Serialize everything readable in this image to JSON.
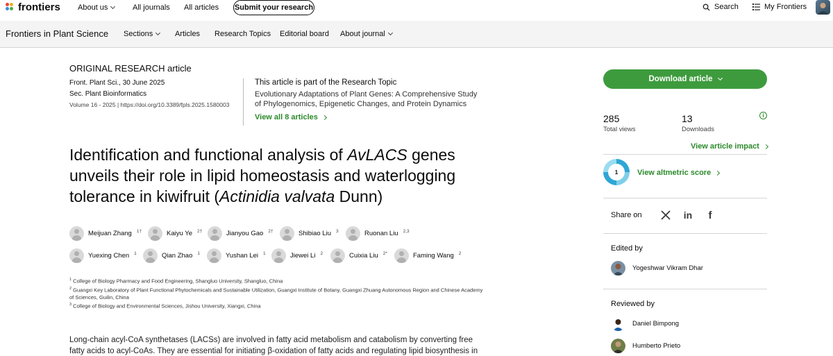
{
  "topbar": {
    "logo_text": "frontiers",
    "nav": [
      "About us",
      "All journals",
      "All articles"
    ],
    "submit_label": "Submit your research",
    "search_label": "Search",
    "my_frontiers_label": "My Frontiers"
  },
  "journal_bar": {
    "title": "Frontiers in Plant Science",
    "nav": [
      "Sections",
      "Articles",
      "Research Topics",
      "Editorial board",
      "About journal"
    ]
  },
  "article": {
    "type": "ORIGINAL RESEARCH article",
    "citation": "Front. Plant Sci., 30 June 2025",
    "section": "Sec. Plant Bioinformatics",
    "volume_doi": "Volume 16 - 2025 | https://doi.org/10.3389/fpls.2025.1580003",
    "topic_heading": "This article is part of the Research Topic",
    "topic_title": "Evolutionary Adaptations of Plant Genes: A Comprehensive Study of Phylogenomics, Epigenetic Changes, and Protein Dynamics",
    "topic_link": "View all 8 articles",
    "title_part1": "Identification and functional analysis of ",
    "title_gene": "AvLACS",
    "title_part2": " genes unveils their role in lipid homeostasis and waterlogging tolerance in kiwifruit (",
    "title_species": "Actinidia valvata",
    "title_part3": " Dunn)",
    "authors": [
      {
        "name": "Meijuan Zhang",
        "sup": "1†"
      },
      {
        "name": "Kaiyu Ye",
        "sup": "2†"
      },
      {
        "name": "Jianyou Gao",
        "sup": "2†"
      },
      {
        "name": "Shibiao Liu",
        "sup": "3"
      },
      {
        "name": "Ruonan Liu",
        "sup": "2,3"
      },
      {
        "name": "Yuexing Chen",
        "sup": "1"
      },
      {
        "name": "Qian Zhao",
        "sup": "1"
      },
      {
        "name": "Yushan Lei",
        "sup": "1"
      },
      {
        "name": "Jiewei Li",
        "sup": "2"
      },
      {
        "name": "Cuixia Liu",
        "sup": "2*"
      },
      {
        "name": "Faming Wang",
        "sup": "2"
      }
    ],
    "affiliations": [
      {
        "num": "1",
        "text": "College of Biology Pharmacy and Food Engineering, Shangluo University, Shangluo, China"
      },
      {
        "num": "2",
        "text": "Guangxi Key Laboratory of Plant Functional Phytochemicals and Sustainable Utilization, Guangxi Institute of Botany, Guangxi Zhuang Autonomous Region and Chinese Academy of Sciences, Guilin, China"
      },
      {
        "num": "3",
        "text": "College of Biology and Environmental Sciences, Jishou University, Xiangxi, China"
      }
    ],
    "abstract": "Long-chain acyl-CoA synthetases (LACSs) are involved in fatty acid metabolism and catabolism by converting free fatty acids to acyl-CoAs. They are essential for initiating β-oxidation of fatty acids and regulating lipid biosynthesis in plant"
  },
  "sidebar": {
    "download_label": "Download article",
    "total_views": "285",
    "total_views_label": "Total views",
    "downloads": "13",
    "downloads_label": "Downloads",
    "impact_link": "View article impact",
    "altmetric_score": "1",
    "altmetric_link": "View altmetric score",
    "share_label": "Share on",
    "edited_by_label": "Edited by",
    "editor": "Yogeshwar Vikram Dhar",
    "reviewed_by_label": "Reviewed by",
    "reviewers": [
      "Daniel Bimpong",
      "Humberto Prieto"
    ]
  },
  "colors": {
    "accent_green": "#3d9b3d",
    "link_green": "#2b8a2b"
  }
}
